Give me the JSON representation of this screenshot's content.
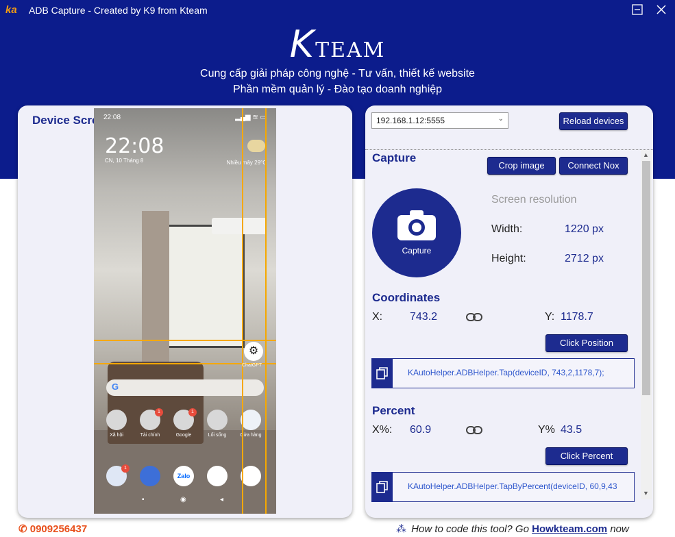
{
  "window": {
    "title": "ADB Capture - Created by K9 from Kteam",
    "logo": "ka"
  },
  "brand": {
    "logo_text": "TEAM",
    "logo_k": "K",
    "tagline_1": "Cung cấp giải pháp công nghệ - Tư vấn, thiết kế website",
    "tagline_2": "Phần mềm quản lý - Đào tạo doanh nghiệp"
  },
  "device_panel": {
    "title": "Device Screen"
  },
  "phone": {
    "time_small": "22:08",
    "clock": "22:08",
    "date": "CN, 10 Tháng 8",
    "weather": "Nhiều mây 29°C",
    "chatgpt_label": "ChatGPT",
    "apps": [
      "Xã hội",
      "Tài chính",
      "Google",
      "Lối sống",
      "Cửa hàng"
    ],
    "badges": [
      "1",
      "1"
    ],
    "dock_badge": "1",
    "dock_zalo": "Zalo"
  },
  "controls": {
    "device_select": "192.168.1.12:5555",
    "reload_button": "Reload devices",
    "crop_button": "Crop image",
    "connect_nox_button": "Connect Nox"
  },
  "capture": {
    "title": "Capture",
    "button_label": "Capture",
    "resolution_label": "Screen resolution",
    "width_label": "Width:",
    "width_value": "1220 px",
    "height_label": "Height:",
    "height_value": "2712 px"
  },
  "coordinates": {
    "title": "Coordinates",
    "x_label": "X:",
    "x_value": "743.2",
    "y_label": "Y:",
    "y_value": "1178.7",
    "button": "Click Position",
    "code": "KAutoHelper.ADBHelper.Tap(deviceID, 743,2,1178,7);"
  },
  "percent": {
    "title": "Percent",
    "x_label": "X%:",
    "x_value": "60.9",
    "y_label": "Y%",
    "y_value": "43.5",
    "button": "Click Percent",
    "code": "KAutoHelper.ADBHelper.TapByPercent(deviceID, 60,9,43"
  },
  "footer": {
    "phone": "0909256437",
    "link_prefix": "How to code this tool? Go",
    "link_text": "Howkteam.com",
    "link_suffix": "now"
  },
  "colors": {
    "brand_navy": "#0c1c8c",
    "accent_blue": "#1d2b8f",
    "guide_orange": "#f5a800",
    "phone_orange": "#e8501c"
  }
}
